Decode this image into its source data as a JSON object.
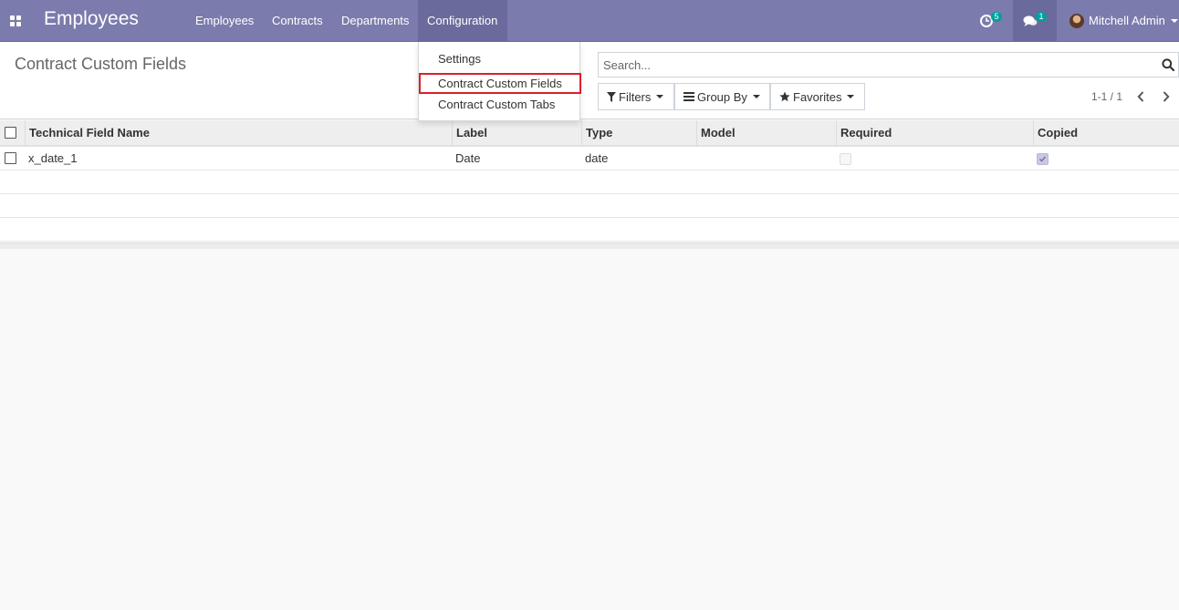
{
  "navbar": {
    "app_name": "Employees",
    "menu": [
      "Employees",
      "Contracts",
      "Departments",
      "Configuration"
    ],
    "activities_count": "5",
    "messages_count": "1",
    "user_name": "Mitchell Admin"
  },
  "dropdown": {
    "items": [
      "Settings",
      "Contract Custom Fields",
      "Contract Custom Tabs"
    ],
    "selected": "Contract Custom Fields"
  },
  "control_panel": {
    "title": "Contract Custom Fields",
    "search_placeholder": "Search...",
    "filters_label": "Filters",
    "group_by_label": "Group By",
    "favorites_label": "Favorites",
    "pager": "1-1 / 1"
  },
  "table": {
    "columns": [
      "Technical Field Name",
      "Label",
      "Type",
      "Model",
      "Required",
      "Copied"
    ],
    "rows": [
      {
        "technical_name": "x_date_1",
        "label": "Date",
        "type": "date",
        "model": "",
        "required": false,
        "copied": true
      }
    ]
  },
  "colors": {
    "navbar": "#7c7bad",
    "highlight_border": "#d9222a",
    "badge": "#00a09d"
  }
}
